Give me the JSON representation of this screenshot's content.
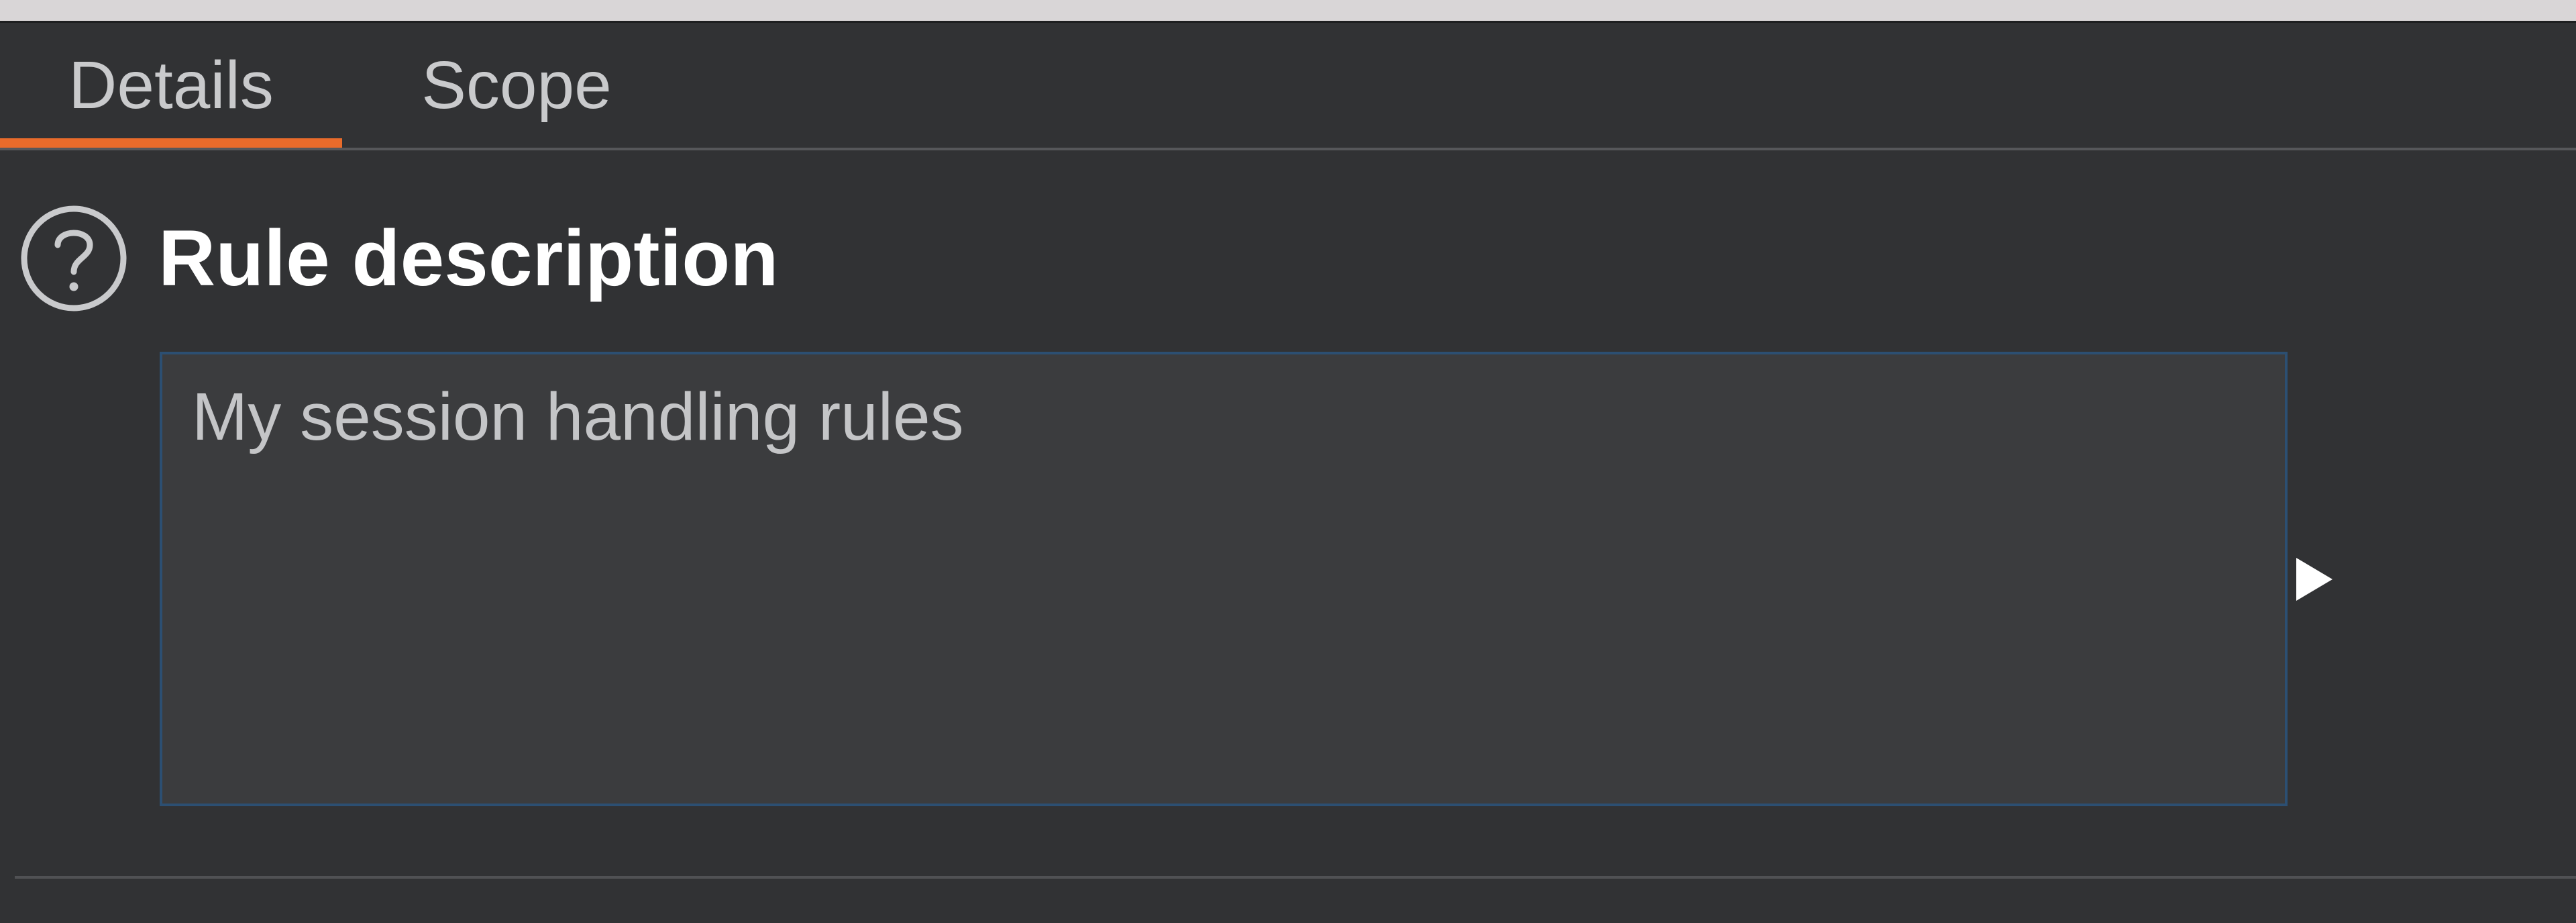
{
  "tabs": [
    {
      "label": "Details",
      "active": true
    },
    {
      "label": "Scope",
      "active": false
    }
  ],
  "section": {
    "title": "Rule description",
    "help_icon": "question-circle-icon"
  },
  "description": {
    "value": "My session handling rules"
  },
  "expand_icon": "triangle-right-icon",
  "colors": {
    "accent": "#e86b2b",
    "background": "#313234",
    "field_border": "#2c4f72",
    "top_strip": "#d9d6d7"
  }
}
